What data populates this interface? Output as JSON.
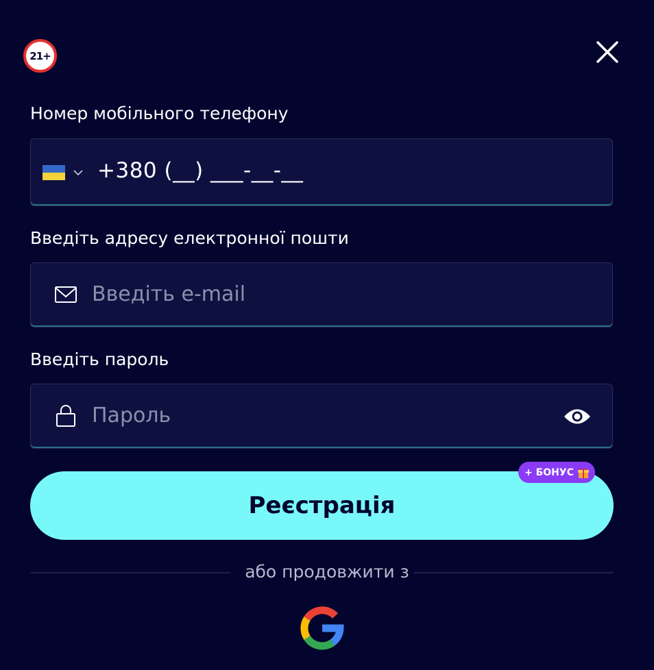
{
  "age_badge": "21+",
  "phone": {
    "label": "Номер мобільного телефону",
    "value": "+380 (__) ___-__-__",
    "country_flag": "flag-ukraine-icon"
  },
  "email": {
    "label": "Введіть адресу електронної пошти",
    "placeholder": "Введіть e-mail",
    "icon": "mail-icon"
  },
  "password": {
    "label": "Введіть пароль",
    "placeholder": "Пароль",
    "icon": "lock-icon",
    "toggle_icon": "eye-icon"
  },
  "register": {
    "label": "Реєстрація",
    "bonus_badge": "+ БОНУС"
  },
  "divider_text": "або продовжити з",
  "social": [
    "google-icon"
  ],
  "colors": {
    "background": "#03052e",
    "field_bg": "#0e1140",
    "primary_button": "#79f8fa",
    "bonus_badge": "#8a3bf5",
    "age_badge_ring": "#e2312f"
  }
}
